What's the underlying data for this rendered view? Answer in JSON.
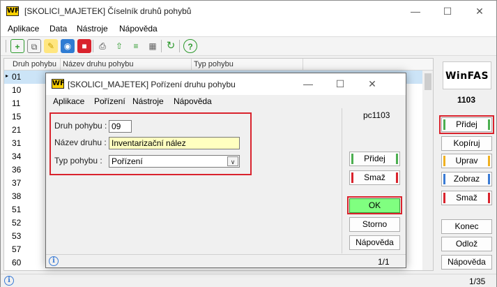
{
  "main": {
    "title": "[SKOLICI_MAJETEK] Číselník druhů pohybů",
    "logo": "WF",
    "menu": [
      "Aplikace",
      "Data",
      "Nástroje",
      "Nápověda"
    ],
    "columns": [
      "Druh pohybu",
      "Název druhu pohybu",
      "Typ pohybu"
    ],
    "codes": [
      "01",
      "10",
      "11",
      "15",
      "21",
      "31",
      "34",
      "36",
      "37",
      "38",
      "51",
      "52",
      "53",
      "57",
      "60"
    ],
    "right_panel": {
      "brand": "WinFAS",
      "company": "1103",
      "buttons": [
        "Přidej",
        "Kopíruj",
        "Uprav",
        "Zobraz",
        "Smaž",
        "Konec",
        "Odlož",
        "Nápověda"
      ]
    },
    "status": {
      "page": "1/35"
    }
  },
  "dialog": {
    "title": "[SKOLICI_MAJETEK] Pořízení druhu pohybu",
    "logo": "WF",
    "menu": [
      "Aplikace",
      "Pořízení",
      "Nástroje",
      "Nápověda"
    ],
    "code_label": "pc1103",
    "fields": {
      "druh_label": "Druh pohybu :",
      "druh_value": "09",
      "nazev_label": "Název druhu :",
      "nazev_value": "Inventarizační nález",
      "typ_label": "Typ pohybu :",
      "typ_value": "Pořízení"
    },
    "buttons": {
      "pridej": "Přidej",
      "smaz": "Smaž",
      "ok": "OK",
      "storno": "Storno",
      "napoveda": "Nápověda"
    },
    "status": {
      "page": "1/1"
    }
  },
  "colors": {
    "accent_red": "#d9232d",
    "ok_green": "#80ff80",
    "btn_green": "#4caf50",
    "btn_orange": "#f0b020",
    "btn_blue": "#3a7bd5",
    "btn_red": "#d9232d",
    "selection": "#cce4f7",
    "yellow_field": "#ffffc0"
  }
}
